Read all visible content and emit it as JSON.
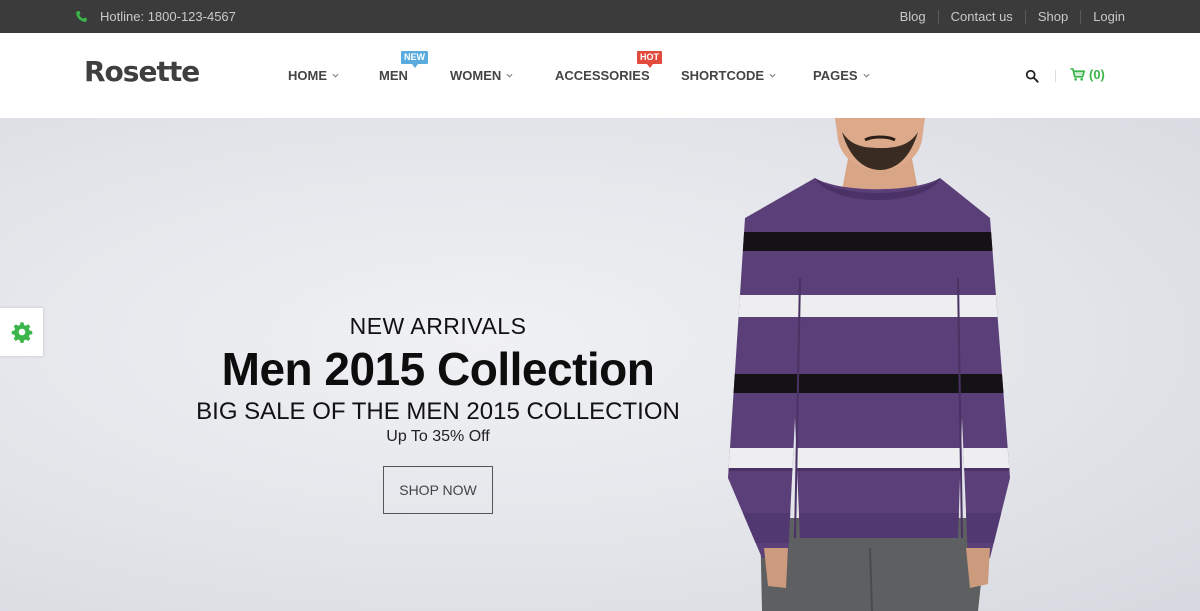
{
  "topbar": {
    "hotline": "Hotline: 1800-123-4567",
    "links": [
      "Blog",
      "Contact us",
      "Shop",
      "Login"
    ]
  },
  "header": {
    "logo": "Rosette",
    "nav": [
      {
        "label": "HOME",
        "dropdown": true
      },
      {
        "label": "MEN",
        "badge": "NEW"
      },
      {
        "label": "WOMEN",
        "dropdown": true
      },
      {
        "label": "ACCESSORIES",
        "badge": "HOT"
      },
      {
        "label": "SHORTCODE",
        "dropdown": true
      },
      {
        "label": "PAGES",
        "dropdown": true
      }
    ],
    "cart": "(0)"
  },
  "hero": {
    "eyebrow": "NEW ARRIVALS",
    "title": "Men 2015 Collection",
    "subtitle": "BIG SALE OF THE MEN 2015 COLLECTION",
    "offer": "Up To 35% Off",
    "button": "SHOP NOW"
  },
  "colors": {
    "topbar_bg": "#3b3b3b",
    "accent_green": "#3cb54a",
    "badge_new": "#5aacdf",
    "badge_hot": "#e24b3b",
    "sweater_purple": "#5b3f78"
  },
  "icons": [
    "phone-icon",
    "search-icon",
    "cart-icon",
    "gear-icon",
    "chevron-down-icon"
  ]
}
